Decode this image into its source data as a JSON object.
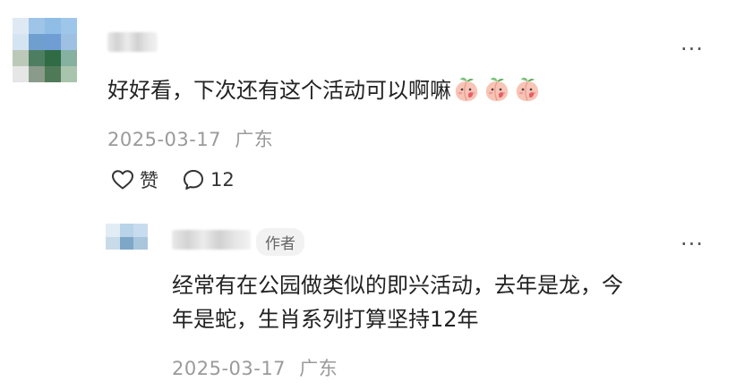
{
  "top_comment": {
    "text": "好好看，下次还有这个活动可以啊嘛",
    "date": "2025-03-17",
    "location": "广东",
    "like_label": "赞",
    "reply_count": "12",
    "more": "···",
    "avatar_colors": [
      [
        "#dfe9f3",
        "#9ec4e8",
        "#8fbde5",
        "#9dc6ea",
        "#ffffff"
      ],
      [
        "#d4e4f1",
        "#6f9fcf",
        "#6e9ed3",
        "#9dc0e3",
        "#ffffff"
      ],
      [
        "#bcc9b8",
        "#4e7e62",
        "#2f6c45",
        "#86b0a0",
        "#ffffff"
      ],
      [
        "#e6e6e6",
        "#8a9b8c",
        "#4f7a58",
        "#a9c4ad",
        "#ffffff"
      ],
      [
        "#ffffff",
        "#ffffff",
        "#ffffff",
        "#ffffff",
        "#ffffff"
      ]
    ],
    "emoji_icons": [
      "peach-emoji-icon",
      "peach-emoji-icon",
      "peach-emoji-icon"
    ]
  },
  "reply": {
    "author_tag": "作者",
    "text_line1": "经常有在公园做类似的即兴活动，去年是龙，今",
    "text_line2": "年是蛇，生肖系列打算坚持12年",
    "date": "2025-03-17",
    "location": "广东",
    "more": "···",
    "avatar_colors": [
      [
        "#e2ecf5",
        "#b9d3e9",
        "#c8dcef",
        "#ffffff"
      ],
      [
        "#c9dbe9",
        "#7da7c7",
        "#a9c6dd",
        "#ffffff"
      ],
      [
        "#ffffff",
        "#ffffff",
        "#ffffff",
        "#ffffff"
      ]
    ]
  }
}
